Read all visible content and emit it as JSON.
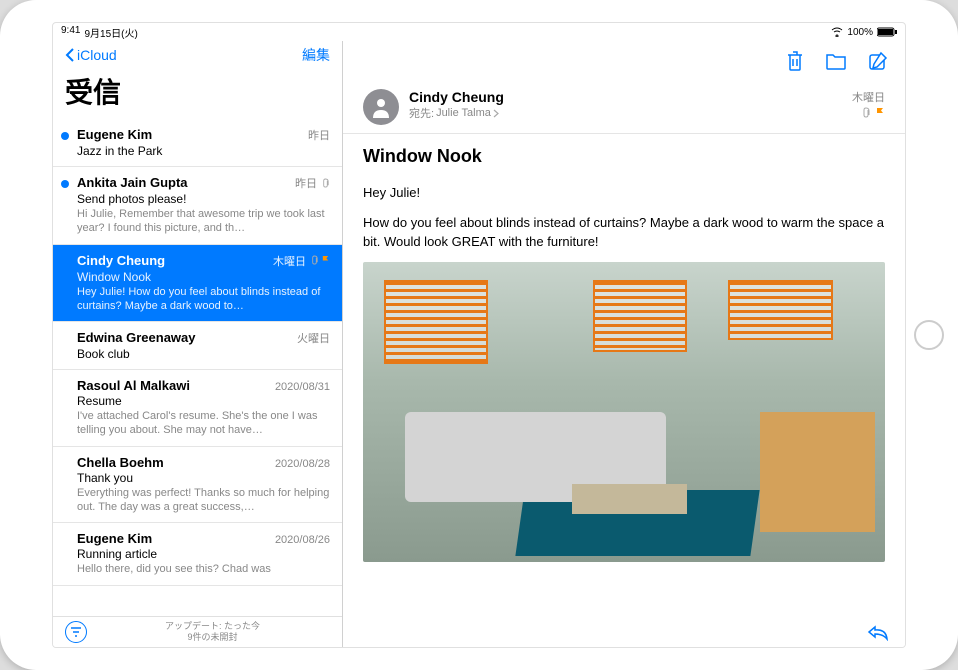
{
  "status": {
    "time": "9:41",
    "date": "9月15日(火)",
    "battery": "100%"
  },
  "sidebar": {
    "back": "iCloud",
    "edit": "編集",
    "title": "受信",
    "footer_line1": "アップデート: たった今",
    "footer_line2": "9件の未開封"
  },
  "messages": [
    {
      "sender": "Eugene Kim",
      "date": "昨日",
      "subject": "Jazz in the Park",
      "preview": "",
      "unread": true,
      "selected": false,
      "clip": false,
      "flag": false
    },
    {
      "sender": "Ankita Jain Gupta",
      "date": "昨日",
      "subject": "Send photos please!",
      "preview": "Hi Julie, Remember that awesome trip we took last year? I found this picture, and th…",
      "unread": true,
      "selected": false,
      "clip": true,
      "flag": false
    },
    {
      "sender": "Cindy Cheung",
      "date": "木曜日",
      "subject": "Window Nook",
      "preview": "Hey Julie! How do you feel about blinds instead of curtains? Maybe a dark wood to…",
      "unread": false,
      "selected": true,
      "clip": true,
      "flag": true
    },
    {
      "sender": "Edwina Greenaway",
      "date": "火曜日",
      "subject": "Book club",
      "preview": "",
      "unread": false,
      "selected": false,
      "clip": false,
      "flag": false
    },
    {
      "sender": "Rasoul Al Malkawi",
      "date": "2020/08/31",
      "subject": "Resume",
      "preview": "I've attached Carol's resume. She's the one I was telling you about. She may not have…",
      "unread": false,
      "selected": false,
      "clip": false,
      "flag": false
    },
    {
      "sender": "Chella Boehm",
      "date": "2020/08/28",
      "subject": "Thank you",
      "preview": "Everything was perfect! Thanks so much for helping out. The day was a great success,…",
      "unread": false,
      "selected": false,
      "clip": false,
      "flag": false
    },
    {
      "sender": "Eugene Kim",
      "date": "2020/08/26",
      "subject": "Running article",
      "preview": "Hello there, did you see this? Chad was",
      "unread": false,
      "selected": false,
      "clip": false,
      "flag": false
    }
  ],
  "mail": {
    "sender": "Cindy Cheung",
    "to_label": "宛先:",
    "to_name": "Julie Talma",
    "date": "木曜日",
    "subject": "Window Nook",
    "greeting": "Hey Julie!",
    "body": "How do you feel about blinds instead of curtains? Maybe a dark wood to warm the space a bit. Would look GREAT with the furniture!"
  }
}
